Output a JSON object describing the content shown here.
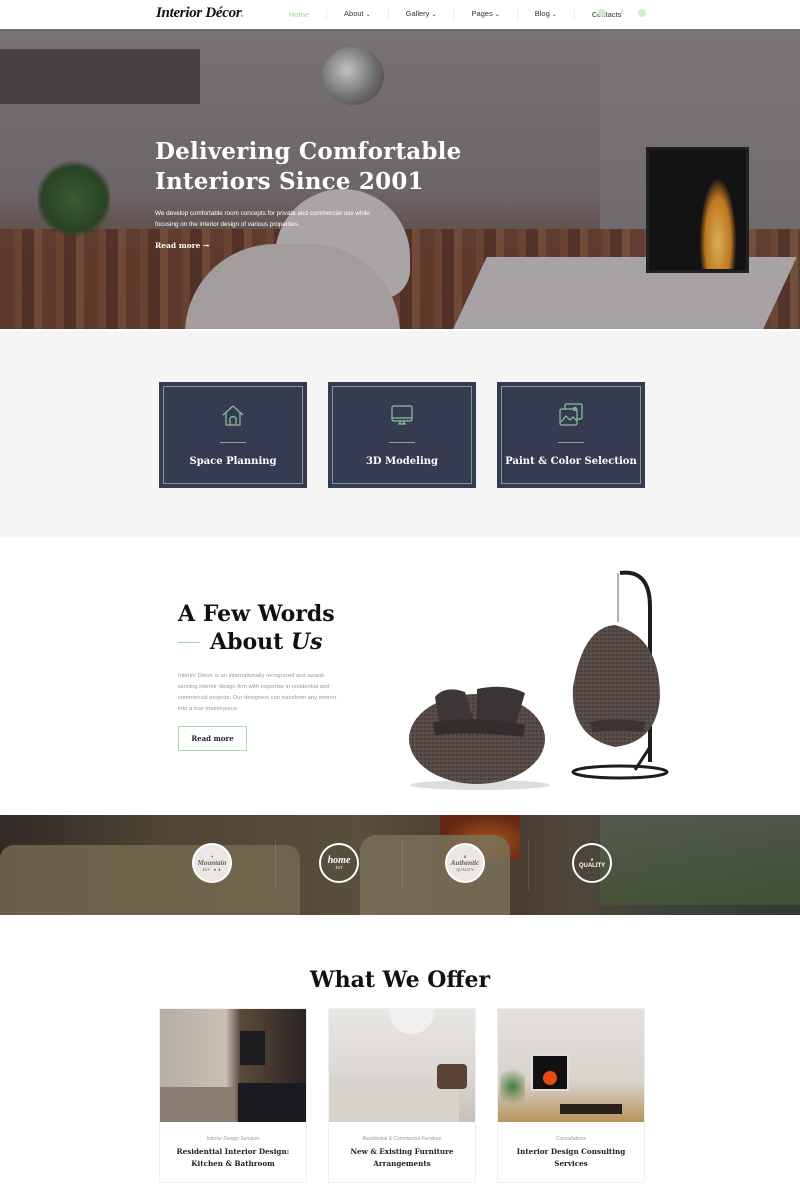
{
  "header": {
    "logo": "Interior Décor",
    "logo_dot": ".",
    "nav": [
      {
        "label": "Home",
        "active": true,
        "dropdown": false
      },
      {
        "label": "About",
        "active": false,
        "dropdown": true
      },
      {
        "label": "Gallery",
        "active": false,
        "dropdown": true
      },
      {
        "label": "Pages",
        "active": false,
        "dropdown": true
      },
      {
        "label": "Blog",
        "active": false,
        "dropdown": true
      },
      {
        "label": "Contacts",
        "active": false,
        "dropdown": false
      }
    ],
    "chevron": "⌄",
    "social": [
      {
        "icon": "instagram-icon",
        "glyph": "◎"
      },
      {
        "icon": "facebook-icon",
        "glyph": "f"
      },
      {
        "icon": "pinterest-icon",
        "glyph": "●"
      }
    ]
  },
  "hero": {
    "title_line1": "Delivering Comfortable",
    "title_line2": "Interiors Since 2001",
    "text": "We develop comfortable room concepts for private and commercial use while focusing on the interior design of various properties.",
    "link": "Read more →"
  },
  "services": [
    {
      "label": "Space Planning",
      "icon": "house-icon"
    },
    {
      "label": "3D Modeling",
      "icon": "monitor-icon"
    },
    {
      "label": "Paint & Color Selection",
      "icon": "image-gallery-icon"
    }
  ],
  "about": {
    "title_line1": "A Few Words",
    "title_line2_plain": "About ",
    "title_line2_italic": "Us",
    "text": "Interior Décor is an internationally recognized and award-winning interior design firm with expertise in residential and commercial projects. Our designers can transform any interior into a true masterpiece.",
    "button": "Read more"
  },
  "badges": [
    {
      "title": "Mountain",
      "sub": "EST · ★ ★"
    },
    {
      "title": "home",
      "sub": "EST"
    },
    {
      "title": "Authentic",
      "sub": "QUALITY"
    },
    {
      "title": "QUALITY",
      "sub": ""
    }
  ],
  "offer": {
    "title": "What We Offer",
    "cards": [
      {
        "category": "Interior Design Services",
        "name": "Residential Interior Design: Kitchen & Bathroom"
      },
      {
        "category": "Residential & Commercial Furniture",
        "name": "New & Existing Furniture Arrangements"
      },
      {
        "category": "Consultations",
        "name": "Interior Design Consulting Services"
      }
    ]
  },
  "colors": {
    "accent": "#9fd39f",
    "card_bg": "#363b52",
    "card_border": "#7a9c8a",
    "services_bg": "#f5f5f5"
  }
}
